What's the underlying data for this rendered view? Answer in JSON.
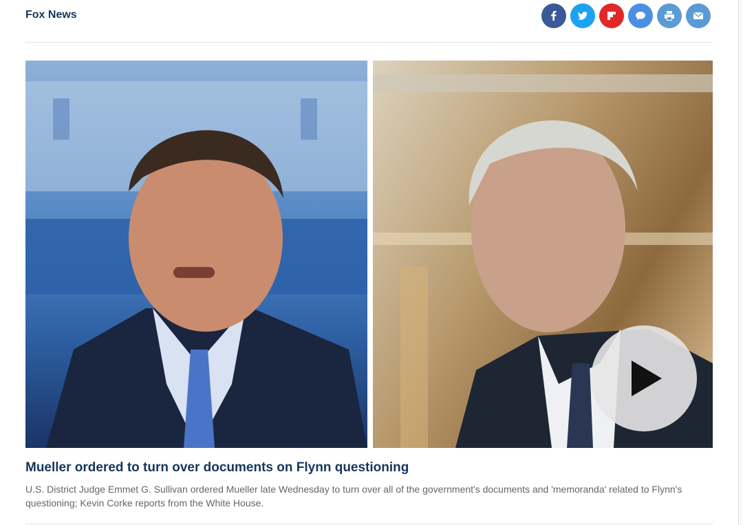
{
  "header": {
    "source": "Fox News",
    "share_buttons": [
      {
        "name": "facebook",
        "icon": "facebook-icon",
        "color": "#3b5998"
      },
      {
        "name": "twitter",
        "icon": "twitter-icon",
        "color": "#1da1f2"
      },
      {
        "name": "flipboard",
        "icon": "flipboard-icon",
        "color": "#e12828"
      },
      {
        "name": "comments",
        "icon": "comment-icon",
        "color": "#4a90e2"
      },
      {
        "name": "print",
        "icon": "print-icon",
        "color": "#5b9bd5"
      },
      {
        "name": "email",
        "icon": "email-icon",
        "color": "#5b9bd5"
      }
    ]
  },
  "video": {
    "play_icon": "play-icon"
  },
  "article": {
    "headline": "Mueller ordered to turn over documents on Flynn questioning",
    "caption": "U.S. District Judge Emmet G. Sullivan ordered Mueller late Wednesday to turn over all of the government's documents and 'memoranda' related to Flynn's questioning; Kevin Corke reports from the White House."
  },
  "colors": {
    "headline": "#17365c",
    "caption": "#666666",
    "rule": "#dfe6ee"
  }
}
